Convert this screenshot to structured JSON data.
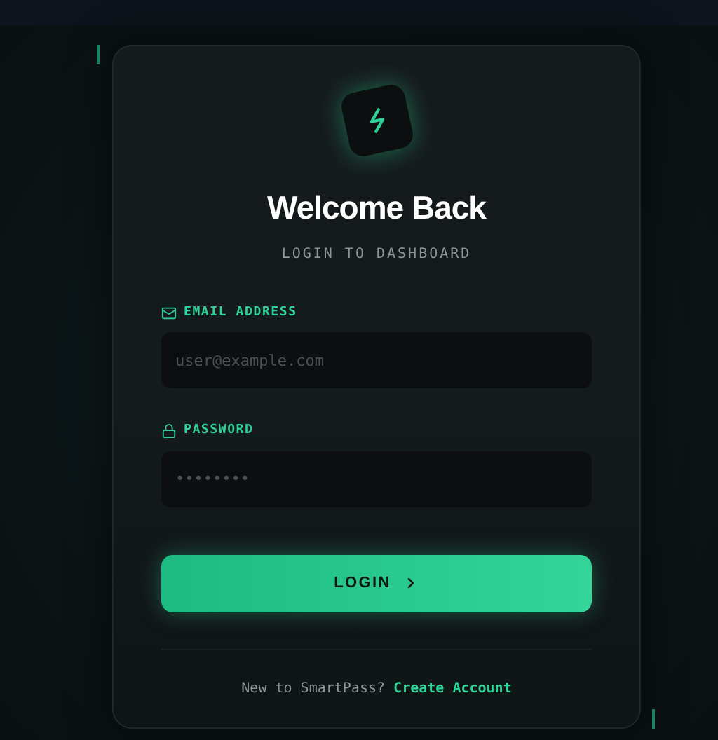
{
  "title": "Welcome Back",
  "subtitle": "LOGIN TO DASHBOARD",
  "fields": [
    {
      "kind": "email",
      "label": "EMAIL ADDRESS",
      "placeholder": "user@example.com"
    },
    {
      "kind": "password",
      "label": "PASSWORD",
      "placeholder": "••••••••"
    }
  ],
  "submit": "LOGIN",
  "footer": {
    "text": "New to SmartPass?",
    "link": "Create Account"
  }
}
